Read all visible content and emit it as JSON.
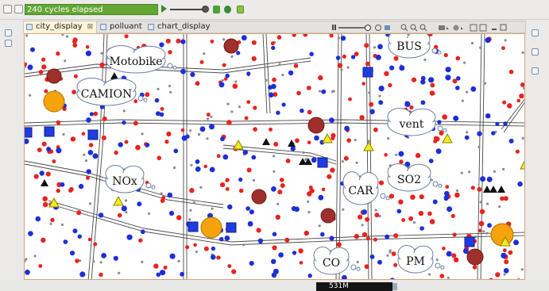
{
  "toolbar": {
    "cycles_label": "240 cycles elapsed"
  },
  "tabs": [
    {
      "label": "city_display",
      "close": "⊠",
      "active": true
    },
    {
      "label": "polluant",
      "active": false
    },
    {
      "label": "chart_display",
      "active": false
    }
  ],
  "display": {
    "clouds": [
      "Motobike",
      "BUS",
      "CAMION",
      "vent",
      "NOx",
      "SO2",
      "CAR",
      "CO",
      "PM"
    ]
  },
  "status": {
    "memory": "531M"
  },
  "colors": {
    "cycles_bar": "#62a633",
    "canvas_border": "#d9a37c",
    "car_dot": "#e8231e",
    "moto_dot": "#1d2fd8",
    "pedestrian_dot": "#8c8c8c",
    "building": "#9e2f2a",
    "factory": "#f5a30a",
    "stop": "#1e3ce0",
    "warning": "#f2ec1d"
  },
  "icons": [
    "monitor-icon",
    "view-icon",
    "play-icon",
    "speed-slider-icon",
    "step-icon",
    "reload-icon",
    "snapshot-icon",
    "layers-icon",
    "zoom-in-icon",
    "zoom-out-icon",
    "zoom-fit-icon",
    "camera-icon",
    "sync-icon",
    "overlay-icon",
    "maximize-icon",
    "minimize-icon",
    "chart-icon",
    "gc-icon"
  ]
}
